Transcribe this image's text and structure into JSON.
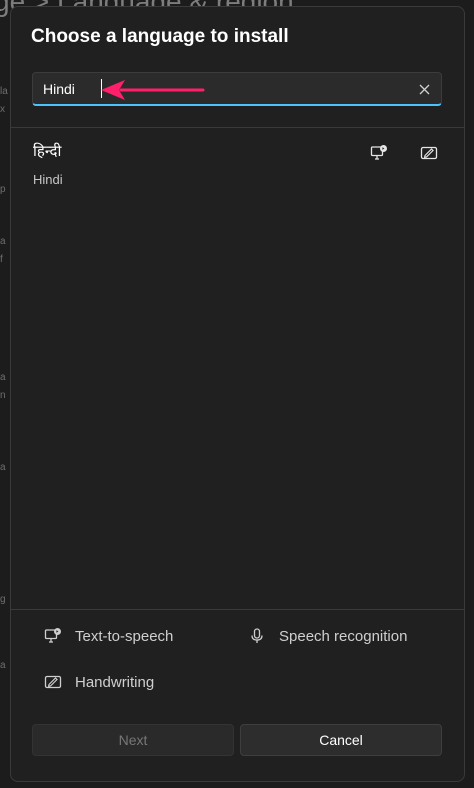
{
  "dialog": {
    "title": "Choose a language to install",
    "search": {
      "value": "Hindi",
      "clear_icon": "close-icon"
    },
    "results": [
      {
        "native_name": "हिन्दी",
        "english_name": "Hindi",
        "features": [
          "text-to-speech-icon",
          "handwriting-icon"
        ]
      }
    ],
    "legend": {
      "text_to_speech": "Text-to-speech",
      "speech_recognition": "Speech recognition",
      "handwriting": "Handwriting"
    },
    "buttons": {
      "next": "Next",
      "cancel": "Cancel"
    }
  },
  "annotation": {
    "arrow_color": "#ff1f6b"
  },
  "backdrop": {
    "title_fragment": "ge > Language & region"
  }
}
